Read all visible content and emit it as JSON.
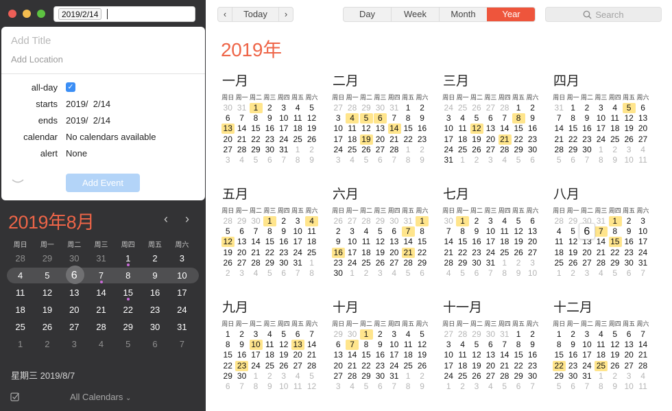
{
  "window": {
    "controls": [
      "close",
      "minimize",
      "maximize"
    ]
  },
  "quick_input": {
    "value": "2019/2/14"
  },
  "popover": {
    "title_placeholder": "Add Title",
    "location_placeholder": "Add Location",
    "rows": [
      {
        "label": "all-day",
        "value": ""
      },
      {
        "label": "starts",
        "value": "2019/  2/14"
      },
      {
        "label": "ends",
        "value": "2019/  2/14"
      },
      {
        "label": "calendar",
        "value": "No calendars available"
      },
      {
        "label": "alert",
        "value": "None"
      }
    ],
    "all_day_checked": true,
    "add_button": "Add Event"
  },
  "mini": {
    "title": "2019年8月",
    "weekdays": [
      "周日",
      "周一",
      "周二",
      "周三",
      "周四",
      "周五",
      "周六"
    ],
    "weeks": [
      [
        [
          "28",
          1
        ],
        [
          "29",
          1
        ],
        [
          "30",
          1
        ],
        [
          "31",
          1
        ],
        [
          "1",
          0,
          "dot"
        ],
        [
          "2",
          0
        ],
        [
          "3",
          0
        ]
      ],
      [
        [
          "4",
          0
        ],
        [
          "5",
          0
        ],
        [
          "6",
          0,
          "today"
        ],
        [
          "7",
          0,
          "dot"
        ],
        [
          "8",
          0
        ],
        [
          "9",
          0
        ],
        [
          "10",
          0
        ]
      ],
      [
        [
          "11",
          0
        ],
        [
          "12",
          0
        ],
        [
          "13",
          0
        ],
        [
          "14",
          0
        ],
        [
          "15",
          0,
          "dot"
        ],
        [
          "16",
          0
        ],
        [
          "17",
          0
        ]
      ],
      [
        [
          "18",
          0
        ],
        [
          "19",
          0
        ],
        [
          "20",
          0
        ],
        [
          "21",
          0
        ],
        [
          "22",
          0
        ],
        [
          "23",
          0
        ],
        [
          "24",
          0
        ]
      ],
      [
        [
          "25",
          0
        ],
        [
          "26",
          0
        ],
        [
          "27",
          0
        ],
        [
          "28",
          0
        ],
        [
          "29",
          0
        ],
        [
          "30",
          0
        ],
        [
          "31",
          0
        ]
      ],
      [
        [
          "1",
          1
        ],
        [
          "2",
          1
        ],
        [
          "3",
          1
        ],
        [
          "4",
          1
        ],
        [
          "5",
          1
        ],
        [
          "6",
          1
        ],
        [
          "7",
          1
        ]
      ]
    ],
    "highlight_week": 1,
    "selected_label": "星期三 2019/8/7",
    "calendars_label": "All Calendars"
  },
  "toolbar": {
    "today": "Today",
    "views": [
      "Day",
      "Week",
      "Month",
      "Year"
    ],
    "active_view": "Year",
    "search_placeholder": "Search"
  },
  "year": {
    "title": "2019年",
    "weekdays": [
      "周日",
      "周一",
      "周二",
      "周三",
      "周四",
      "周五",
      "周六"
    ],
    "months": [
      {
        "name": "一月",
        "weeks": [
          [
            "30o",
            "31o",
            "1h",
            "2",
            "3",
            "4",
            "5"
          ],
          [
            "6",
            "7",
            "8",
            "9",
            "10",
            "11",
            "12"
          ],
          [
            "13h",
            "14",
            "15",
            "16",
            "17",
            "18",
            "19"
          ],
          [
            "20",
            "21",
            "22",
            "23",
            "24",
            "25",
            "26"
          ],
          [
            "27",
            "28",
            "29",
            "30",
            "31",
            "1o",
            "2o"
          ],
          [
            "3o",
            "4o",
            "5o",
            "6o",
            "7o",
            "8o",
            "9o"
          ]
        ]
      },
      {
        "name": "二月",
        "weeks": [
          [
            "27o",
            "28o",
            "29o",
            "30o",
            "31o",
            "1",
            "2"
          ],
          [
            "3",
            "4h",
            "5h",
            "6h",
            "7",
            "8",
            "9"
          ],
          [
            "10",
            "11",
            "12",
            "13",
            "14h",
            "15",
            "16"
          ],
          [
            "17",
            "18",
            "19h",
            "20",
            "21",
            "22",
            "23"
          ],
          [
            "24",
            "25",
            "26",
            "27",
            "28",
            "1o",
            "2o"
          ],
          [
            "3o",
            "4o",
            "5o",
            "6o",
            "7o",
            "8o",
            "9o"
          ]
        ]
      },
      {
        "name": "三月",
        "weeks": [
          [
            "24o",
            "25o",
            "26o",
            "27o",
            "28o",
            "1",
            "2"
          ],
          [
            "3",
            "4",
            "5",
            "6",
            "7",
            "8h",
            "9"
          ],
          [
            "10",
            "11",
            "12h",
            "13",
            "14",
            "15",
            "16"
          ],
          [
            "17",
            "18",
            "19",
            "20",
            "21h",
            "22",
            "23"
          ],
          [
            "24",
            "25",
            "26",
            "27",
            "28",
            "29",
            "30"
          ],
          [
            "31",
            "1o",
            "2o",
            "3o",
            "4o",
            "5o",
            "6o"
          ]
        ]
      },
      {
        "name": "四月",
        "weeks": [
          [
            "31o",
            "1",
            "2",
            "3",
            "4",
            "5h",
            "6"
          ],
          [
            "7",
            "8",
            "9",
            "10",
            "11",
            "12",
            "13"
          ],
          [
            "14",
            "15",
            "16",
            "17",
            "18",
            "19",
            "20"
          ],
          [
            "21",
            "22",
            "23",
            "24",
            "25",
            "26",
            "27"
          ],
          [
            "28",
            "29",
            "30",
            "1o",
            "2o",
            "3o",
            "4o"
          ],
          [
            "5o",
            "6o",
            "7o",
            "8o",
            "9o",
            "10o",
            "11o"
          ]
        ]
      },
      {
        "name": "五月",
        "weeks": [
          [
            "28o",
            "29o",
            "30o",
            "1h",
            "2",
            "3",
            "4h"
          ],
          [
            "5",
            "6",
            "7",
            "8",
            "9",
            "10",
            "11"
          ],
          [
            "12h",
            "13",
            "14",
            "15",
            "16",
            "17",
            "18"
          ],
          [
            "19",
            "20",
            "21",
            "22",
            "23",
            "24",
            "25"
          ],
          [
            "26",
            "27",
            "28",
            "29",
            "30",
            "31",
            "1o"
          ],
          [
            "2o",
            "3o",
            "4o",
            "5o",
            "6o",
            "7o",
            "8o"
          ]
        ]
      },
      {
        "name": "六月",
        "weeks": [
          [
            "26o",
            "27o",
            "28o",
            "29o",
            "30o",
            "31o",
            "1h"
          ],
          [
            "2",
            "3",
            "4",
            "5",
            "6",
            "7h",
            "8"
          ],
          [
            "9",
            "10",
            "11",
            "12",
            "13",
            "14",
            "15"
          ],
          [
            "16h",
            "17",
            "18",
            "19",
            "20",
            "21h",
            "22"
          ],
          [
            "23",
            "24",
            "25",
            "26",
            "27",
            "28",
            "29"
          ],
          [
            "30",
            "1o",
            "2o",
            "3o",
            "4o",
            "5o",
            "6o"
          ]
        ]
      },
      {
        "name": "七月",
        "weeks": [
          [
            "30o",
            "1h",
            "2",
            "3",
            "4",
            "5",
            "6"
          ],
          [
            "7",
            "8",
            "9",
            "10",
            "11",
            "12",
            "13"
          ],
          [
            "14",
            "15",
            "16",
            "17",
            "18",
            "19",
            "20"
          ],
          [
            "21",
            "22",
            "23",
            "24",
            "25",
            "26",
            "27"
          ],
          [
            "28",
            "29",
            "30",
            "31",
            "1o",
            "2o",
            "3o"
          ],
          [
            "4o",
            "5o",
            "6o",
            "7o",
            "8o",
            "9o",
            "10o"
          ]
        ]
      },
      {
        "name": "八月",
        "weeks": [
          [
            "28o",
            "29o",
            "30o",
            "31o",
            "1h",
            "2",
            "3"
          ],
          [
            "4",
            "5",
            "6t",
            "7h",
            "8",
            "9",
            "10"
          ],
          [
            "11",
            "12",
            "13",
            "14",
            "15h",
            "16",
            "17"
          ],
          [
            "18",
            "19",
            "20",
            "21",
            "22",
            "23",
            "24"
          ],
          [
            "25",
            "26",
            "27",
            "28",
            "29",
            "30",
            "31"
          ],
          [
            "1o",
            "2o",
            "3o",
            "4o",
            "5o",
            "6o",
            "7o"
          ]
        ]
      },
      {
        "name": "九月",
        "weeks": [
          [
            "1",
            "2",
            "3",
            "4",
            "5",
            "6",
            "7"
          ],
          [
            "8",
            "9",
            "10h",
            "11",
            "12",
            "13h",
            "14"
          ],
          [
            "15",
            "16",
            "17",
            "18",
            "19",
            "20",
            "21"
          ],
          [
            "22",
            "23h",
            "24",
            "25",
            "26",
            "27",
            "28"
          ],
          [
            "29",
            "30",
            "1o",
            "2o",
            "3o",
            "4o",
            "5o"
          ],
          [
            "6o",
            "7o",
            "8o",
            "9o",
            "10o",
            "11o",
            "12o"
          ]
        ]
      },
      {
        "name": "十月",
        "weeks": [
          [
            "29o",
            "30o",
            "1h",
            "2",
            "3",
            "4",
            "5"
          ],
          [
            "6",
            "7h",
            "8",
            "9",
            "10",
            "11",
            "12"
          ],
          [
            "13",
            "14",
            "15",
            "16",
            "17",
            "18",
            "19"
          ],
          [
            "20",
            "21",
            "22",
            "23",
            "24",
            "25",
            "26"
          ],
          [
            "27",
            "28",
            "29",
            "30",
            "31",
            "1o",
            "2o"
          ],
          [
            "3o",
            "4o",
            "5o",
            "6o",
            "7o",
            "8o",
            "9o"
          ]
        ]
      },
      {
        "name": "十一月",
        "weeks": [
          [
            "27o",
            "28o",
            "29o",
            "30o",
            "31o",
            "1",
            "2"
          ],
          [
            "3",
            "4",
            "5",
            "6",
            "7",
            "8",
            "9"
          ],
          [
            "10",
            "11",
            "12",
            "13",
            "14",
            "15",
            "16"
          ],
          [
            "17",
            "18",
            "19",
            "20",
            "21",
            "22",
            "23"
          ],
          [
            "24",
            "25",
            "26",
            "27",
            "28",
            "29",
            "30"
          ],
          [
            "1o",
            "2o",
            "3o",
            "4o",
            "5o",
            "6o",
            "7o"
          ]
        ]
      },
      {
        "name": "十二月",
        "weeks": [
          [
            "1",
            "2",
            "3",
            "4",
            "5",
            "6",
            "7"
          ],
          [
            "8",
            "9",
            "10",
            "11",
            "12",
            "13",
            "14"
          ],
          [
            "15",
            "16",
            "17",
            "18",
            "19",
            "20",
            "21"
          ],
          [
            "22h",
            "23",
            "24",
            "25h",
            "26",
            "27",
            "28"
          ],
          [
            "29",
            "30",
            "31",
            "1o",
            "2o",
            "3o",
            "4o"
          ],
          [
            "5o",
            "6o",
            "7o",
            "8o",
            "9o",
            "10o",
            "11o"
          ]
        ]
      }
    ]
  },
  "colors": {
    "accent": "#ee553c",
    "title": "#ee6548",
    "highlight": "#ffe58c",
    "sidebar": "#333335",
    "event_dot": "#c86ad6"
  }
}
